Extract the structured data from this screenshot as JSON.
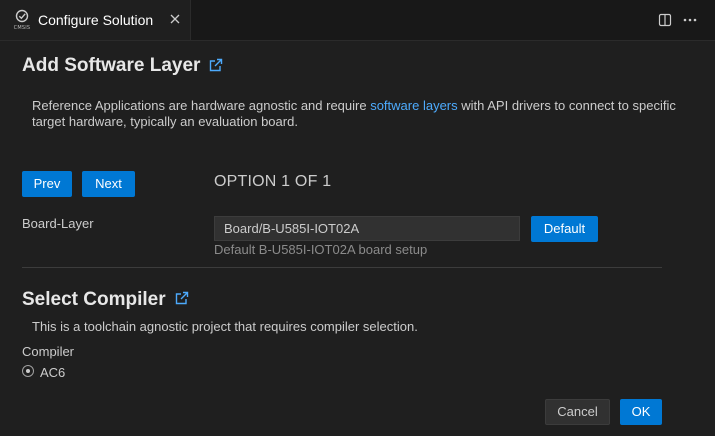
{
  "tab": {
    "logo_text": "CMSIS",
    "title": "Configure Solution"
  },
  "software_layer": {
    "heading": "Add Software Layer",
    "desc_before": "Reference Applications are hardware agnostic and require ",
    "desc_link": "software layers",
    "desc_after": " with API drivers to connect to specific target hardware, typically an evaluation board.",
    "prev_label": "Prev",
    "next_label": "Next",
    "option_text": "OPTION 1 OF 1",
    "board_layer_label": "Board-Layer",
    "board_layer_value": "Board/B-U585I-IOT02A",
    "default_label": "Default",
    "board_layer_hint": "Default B-U585I-IOT02A board setup"
  },
  "compiler": {
    "heading": "Select Compiler",
    "desc": "This is a toolchain agnostic project that requires compiler selection.",
    "label": "Compiler",
    "options": [
      {
        "label": "AC6",
        "selected": true
      }
    ]
  },
  "footer": {
    "cancel_label": "Cancel",
    "ok_label": "OK"
  },
  "colors": {
    "accent": "#0078d4",
    "link": "#4daafc",
    "background": "#1f1f1f"
  }
}
